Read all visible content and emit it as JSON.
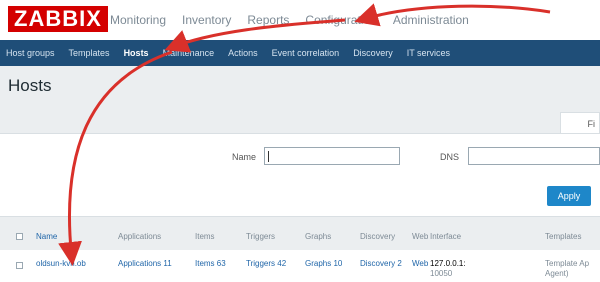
{
  "app": {
    "logo": "ZABBIX",
    "brand_color": "#d40000"
  },
  "main_menu": [
    "Monitoring",
    "Inventory",
    "Reports",
    "Configuration",
    "Administration"
  ],
  "sub_menu": [
    "Host groups",
    "Templates",
    "Hosts",
    "Maintenance",
    "Actions",
    "Event correlation",
    "Discovery",
    "IT services"
  ],
  "page": {
    "title": "Hosts",
    "filter_tab": "Fi"
  },
  "filter": {
    "name_label": "Name",
    "dns_label": "DNS",
    "name_value": "",
    "dns_value": "",
    "apply_label": "Apply"
  },
  "table": {
    "columns": [
      "Name",
      "Applications",
      "Items",
      "Triggers",
      "Graphs",
      "Discovery",
      "Web",
      "Interface",
      "Templates"
    ],
    "row": {
      "name": "oldsun-kvn.ob",
      "applications": "Applications 11",
      "items": "Items 63",
      "triggers": "Triggers 42",
      "graphs": "Graphs 10",
      "discovery": "Discovery 2",
      "web": "Web",
      "interface_line1": "127.0.0.1:",
      "interface_line2": "10050",
      "templates_line1": "Template Ap",
      "templates_line2": "Agent)"
    }
  },
  "colors": {
    "header_bar": "#1f4e78",
    "link": "#1f65a8",
    "apply": "#1e87c9",
    "annotation": "#d9302a"
  }
}
